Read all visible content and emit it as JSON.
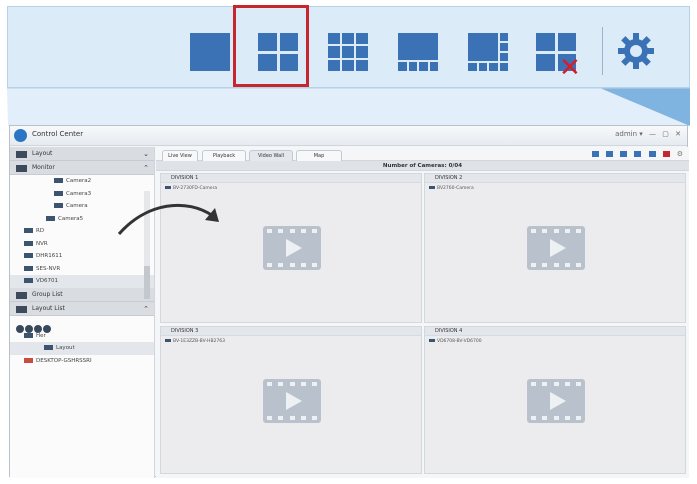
{
  "window": {
    "title": "Control Center"
  },
  "titlebar": {
    "user": "admin ▾",
    "controls": [
      "—",
      "▢",
      "✕"
    ]
  },
  "sidebar": {
    "sections": [
      {
        "label": "Layout"
      },
      {
        "label": "Monitor"
      }
    ],
    "tree": [
      {
        "label": "Camera2"
      },
      {
        "label": "Camera3"
      },
      {
        "label": "Camera"
      },
      {
        "label": "Camera5"
      },
      {
        "label": "RD"
      },
      {
        "label": "NVR"
      },
      {
        "label": "DHR1611"
      },
      {
        "label": "SES-NVR"
      },
      {
        "label": "VD6701"
      }
    ],
    "group_list": "Group List",
    "layout_list": "Layout List",
    "sub_tree": [
      {
        "label": "Her"
      },
      {
        "label": "Layout"
      }
    ],
    "pc_name": "DESKTOP-GSHRSSRI"
  },
  "tabs": [
    {
      "label": "Live View"
    },
    {
      "label": "Playback"
    },
    {
      "label": "Video Wall"
    },
    {
      "label": "Map"
    }
  ],
  "camera_count": "Number of Cameras: 0/04",
  "divisions": [
    {
      "title": "DIVISION 1",
      "camera": "BV-2730FD-Camera"
    },
    {
      "title": "DIVISION 2",
      "camera": "BV2760-Camera"
    },
    {
      "title": "DIVISION 3",
      "camera": "BV-1E3ZZB-BV-HB2763"
    },
    {
      "title": "DIVISION 4",
      "camera": "VD6708-BV-VD6700"
    }
  ],
  "zoom_toolbar": {
    "icons": [
      "layout-1x1-icon",
      "layout-2x2-icon",
      "layout-3x3-icon",
      "layout-wide-icon",
      "layout-side-icon",
      "layout-clear-icon",
      "settings-gear-icon"
    ],
    "selected": "layout-2x2-icon",
    "accent": "#3b72b6",
    "highlight": "#c6262e"
  }
}
